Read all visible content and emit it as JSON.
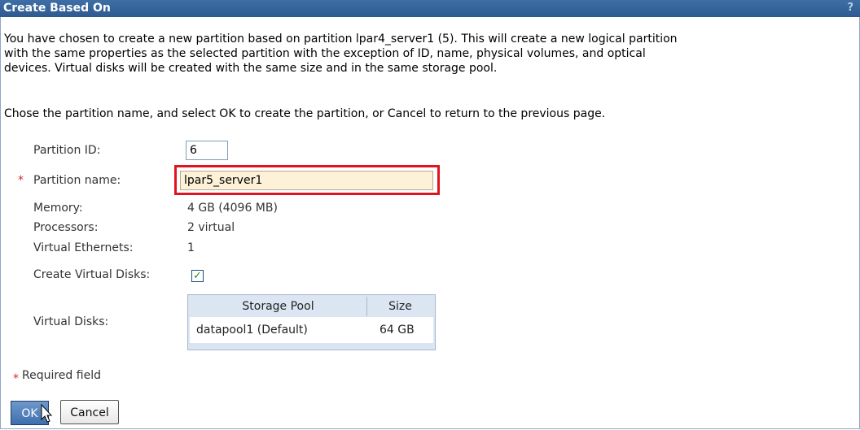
{
  "dialog": {
    "title": "Create Based On",
    "help_icon": "?"
  },
  "intro": {
    "line1": "You have chosen to create a new partition based on partition lpar4_server1 (5). This will create a new logical partition",
    "line2": "with the same properties as the selected partition with the exception of ID, name, physical volumes, and optical",
    "line3": "devices. Virtual disks will be created with the same size and in the same storage pool.",
    "instruction": "Chose the partition name, and select OK to create the partition, or Cancel to return to the previous page."
  },
  "form": {
    "partition_id": {
      "label": "Partition ID:",
      "value": "6"
    },
    "partition_name": {
      "required_marker": "*",
      "label": "Partition name:",
      "value": "lpar5_server1"
    },
    "memory": {
      "label": "Memory:",
      "value": "4 GB (4096 MB)"
    },
    "processors": {
      "label": "Processors:",
      "value": "2 virtual"
    },
    "virtual_ethernets": {
      "label": "Virtual Ethernets:",
      "value": "1"
    },
    "create_virtual_disks": {
      "label": "Create Virtual Disks:",
      "checked": true,
      "check_glyph": "✓"
    },
    "virtual_disks": {
      "label": "Virtual Disks:"
    }
  },
  "disks_table": {
    "columns": [
      "Storage Pool",
      "Size"
    ],
    "rows": [
      [
        "datapool1 (Default)",
        "64 GB"
      ]
    ]
  },
  "footer": {
    "required_marker": "*",
    "required_text": "Required field",
    "ok_label": "OK",
    "cancel_label": "Cancel"
  },
  "colors": {
    "title_bar": "#2c5a91",
    "highlight_border": "#e0141d",
    "required": "#d9262b",
    "name_field_bg": "#fdf2d7"
  }
}
